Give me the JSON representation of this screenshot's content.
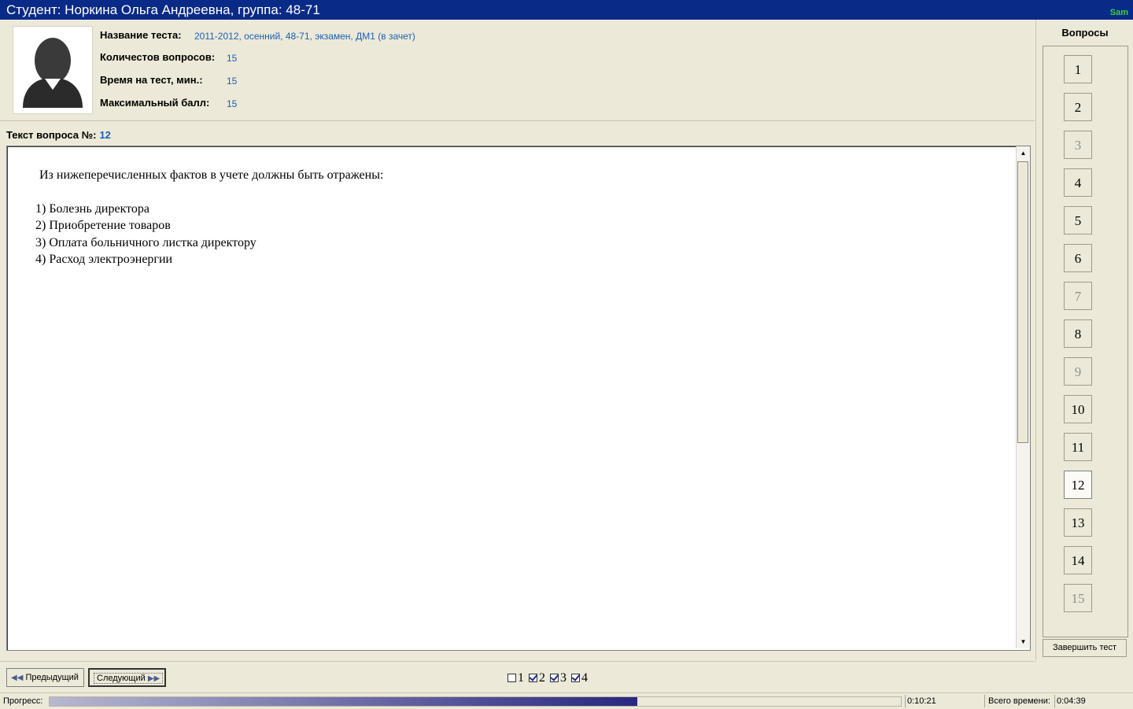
{
  "window": {
    "title": "Студент: Норкина Ольга Андреевна, группа: 48-71",
    "logo_text": "Sam"
  },
  "info": {
    "test_name_label": "Название теста:",
    "test_name_value": "2011-2012, осенний, 48-71, экзамен, ДМ1 (в зачет)",
    "questions_count_label": "Количестов вопросов:",
    "questions_count_value": "15",
    "time_label": "Время на тест, мин.:",
    "time_value": "15",
    "max_score_label": "Максимальный балл:",
    "max_score_value": "15"
  },
  "question": {
    "label": "Текст вопроса №:",
    "number": "12",
    "heading": "Из нижеперечисленных фактов в учете должны быть отражены:",
    "items": [
      "1) Болезнь директора",
      "2) Приобретение товаров",
      "3) Оплата больничного листка директору",
      "4) Расход электроэнергии"
    ]
  },
  "sidebar": {
    "title": "Вопросы",
    "questions": [
      {
        "label": "1",
        "state": "normal"
      },
      {
        "label": "2",
        "state": "normal"
      },
      {
        "label": "3",
        "state": "disabled"
      },
      {
        "label": "4",
        "state": "normal"
      },
      {
        "label": "5",
        "state": "normal"
      },
      {
        "label": "6",
        "state": "normal"
      },
      {
        "label": "7",
        "state": "disabled"
      },
      {
        "label": "8",
        "state": "normal"
      },
      {
        "label": "9",
        "state": "disabled"
      },
      {
        "label": "10",
        "state": "normal"
      },
      {
        "label": "11",
        "state": "normal"
      },
      {
        "label": "12",
        "state": "current"
      },
      {
        "label": "13",
        "state": "normal"
      },
      {
        "label": "14",
        "state": "normal"
      },
      {
        "label": "15",
        "state": "disabled"
      }
    ],
    "finish_label": "Завершить тест"
  },
  "nav": {
    "prev_label": "Предыдущий",
    "next_label": "Следующий"
  },
  "answers": [
    {
      "label": "1",
      "checked": false
    },
    {
      "label": "2",
      "checked": true
    },
    {
      "label": "3",
      "checked": true
    },
    {
      "label": "4",
      "checked": true
    }
  ],
  "status": {
    "progress_label": "Прогресс:",
    "progress_fraction": 0.69,
    "elapsed": "0:10:21",
    "total_label": "Всего времени:",
    "total": "0:04:39"
  }
}
